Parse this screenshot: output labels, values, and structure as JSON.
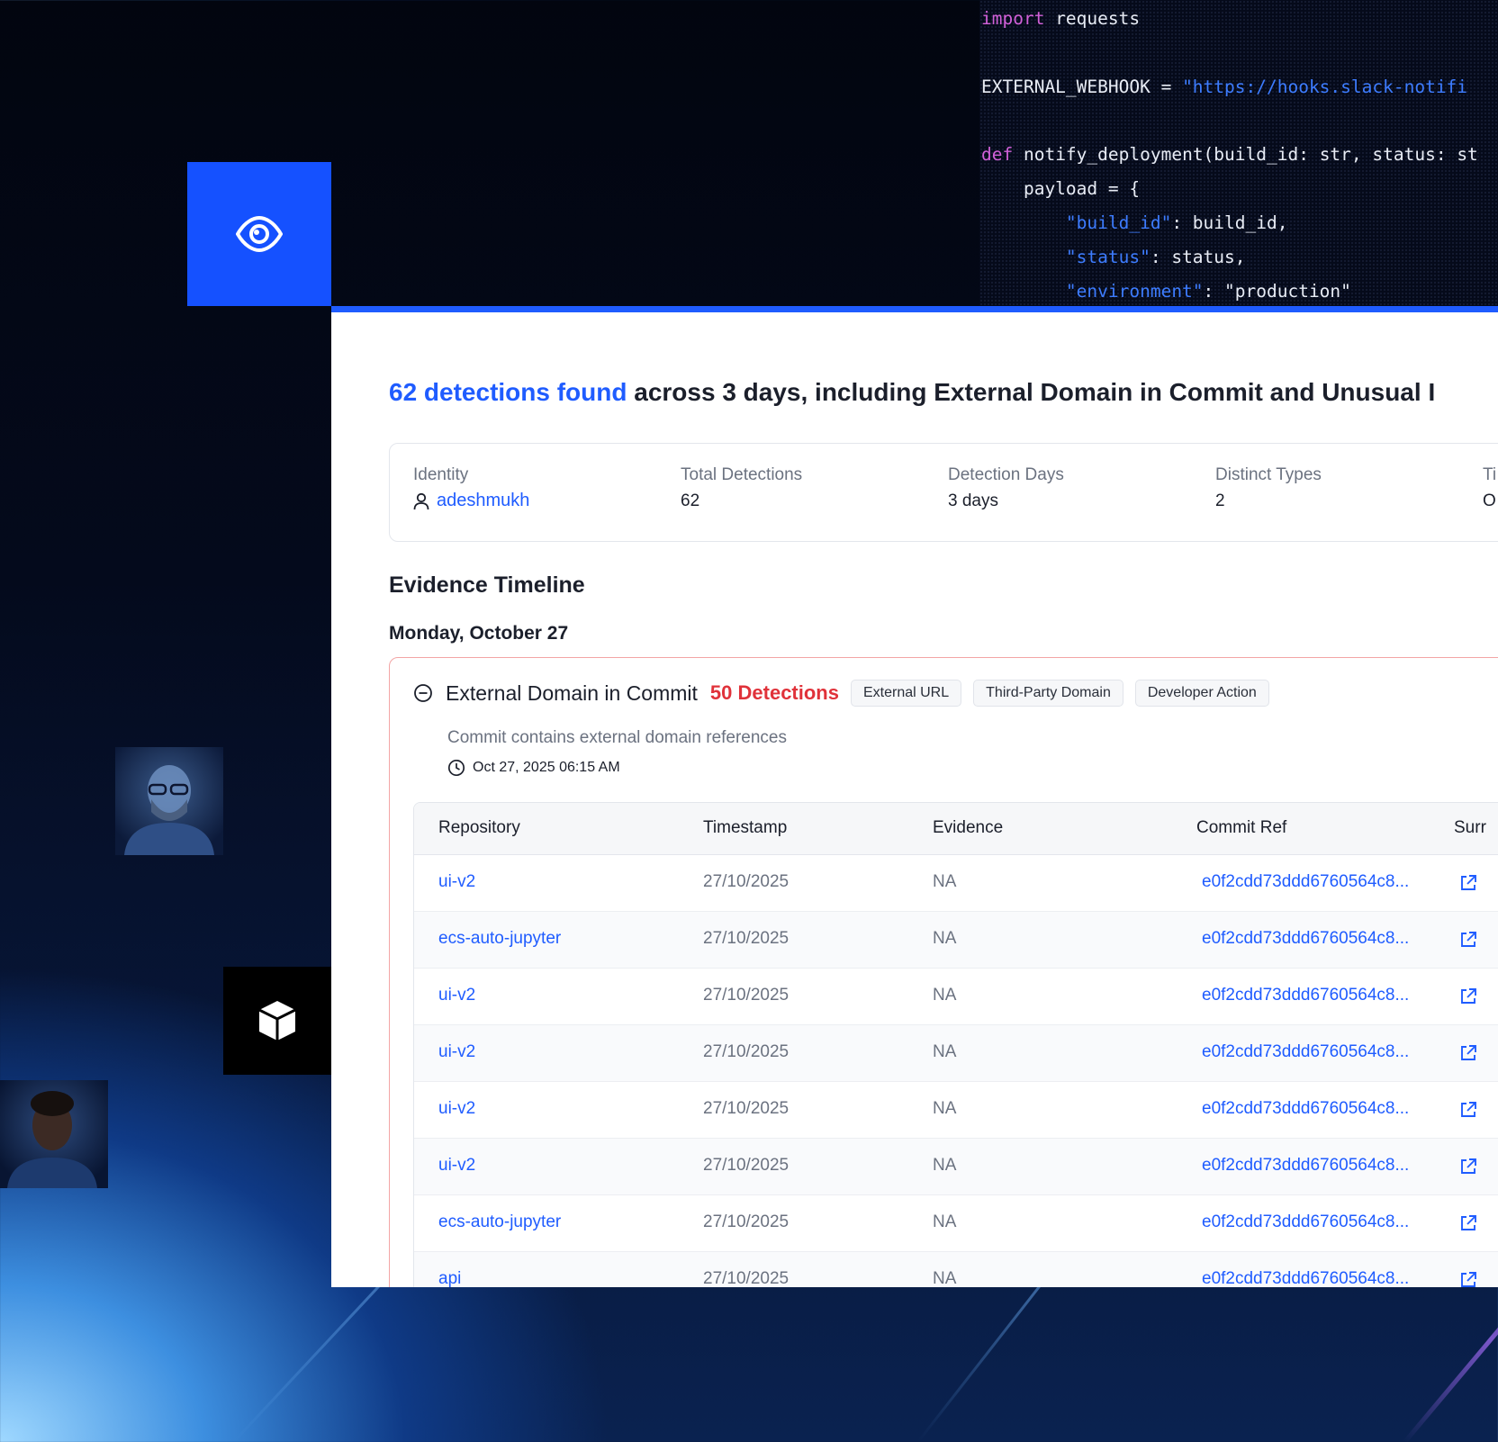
{
  "code": {
    "lines": [
      {
        "k": "import",
        "t": " requests",
        "s": ""
      },
      {
        "k": "",
        "t": "",
        "s": ""
      },
      {
        "k": "",
        "t": "EXTERNAL_WEBHOOK = ",
        "s": "\"https://hooks.slack-notifi"
      },
      {
        "k": "",
        "t": "",
        "s": ""
      },
      {
        "k": "def",
        "t": " notify_deployment(build_id: str, status: st",
        "s": ""
      },
      {
        "k": "",
        "t": "    payload = {",
        "s": ""
      },
      {
        "k": "",
        "t": "",
        "s": "        \"build_id\"",
        "t2": ": build_id,"
      },
      {
        "k": "",
        "t": "",
        "s": "        \"status\"",
        "t2": ": status,"
      },
      {
        "k": "",
        "t": "",
        "s": "        \"environment\"",
        "t2": ": \"production\""
      }
    ]
  },
  "headline": {
    "highlight": "62 detections found",
    "rest": " across 3 days, including External Domain in Commit and Unusual I"
  },
  "summary": {
    "identity_label": "Identity",
    "identity_value": "adeshmukh",
    "total_label": "Total Detections",
    "total_value": "62",
    "days_label": "Detection Days",
    "days_value": "3 days",
    "types_label": "Distinct Types",
    "types_value": "2",
    "extra_label": "Ti",
    "extra_value": "O"
  },
  "timeline": {
    "title": "Evidence Timeline",
    "day": "Monday, October 27"
  },
  "detection": {
    "title": "External Domain in Commit",
    "count": "50 Detections",
    "tags": [
      "External URL",
      "Third-Party Domain",
      "Developer Action"
    ],
    "description": "Commit contains external domain references",
    "time": "Oct 27, 2025 06:15 AM"
  },
  "table": {
    "headers": [
      "Repository",
      "Timestamp",
      "Evidence",
      "Commit Ref",
      "Surr"
    ],
    "rows": [
      {
        "repo": "ui-v2",
        "ts": "27/10/2025",
        "ev": "NA",
        "ref": "e0f2cdd73ddd6760564c8..."
      },
      {
        "repo": "ecs-auto-jupyter",
        "ts": "27/10/2025",
        "ev": "NA",
        "ref": "e0f2cdd73ddd6760564c8..."
      },
      {
        "repo": "ui-v2",
        "ts": "27/10/2025",
        "ev": "NA",
        "ref": "e0f2cdd73ddd6760564c8..."
      },
      {
        "repo": "ui-v2",
        "ts": "27/10/2025",
        "ev": "NA",
        "ref": "e0f2cdd73ddd6760564c8..."
      },
      {
        "repo": "ui-v2",
        "ts": "27/10/2025",
        "ev": "NA",
        "ref": "e0f2cdd73ddd6760564c8..."
      },
      {
        "repo": "ui-v2",
        "ts": "27/10/2025",
        "ev": "NA",
        "ref": "e0f2cdd73ddd6760564c8..."
      },
      {
        "repo": "ecs-auto-jupyter",
        "ts": "27/10/2025",
        "ev": "NA",
        "ref": "e0f2cdd73ddd6760564c8..."
      },
      {
        "repo": "api",
        "ts": "27/10/2025",
        "ev": "NA",
        "ref": "e0f2cdd73ddd6760564c8..."
      }
    ]
  },
  "icons": {
    "eye": "eye-icon",
    "cube": "cube-icon",
    "user": "user-icon",
    "collapse": "minus-circle-icon",
    "clock": "clock-icon",
    "external": "external-link-icon"
  },
  "colors": {
    "accent": "#1f5cff",
    "danger": "#e0323a",
    "card_border": "#f3a5a5"
  }
}
